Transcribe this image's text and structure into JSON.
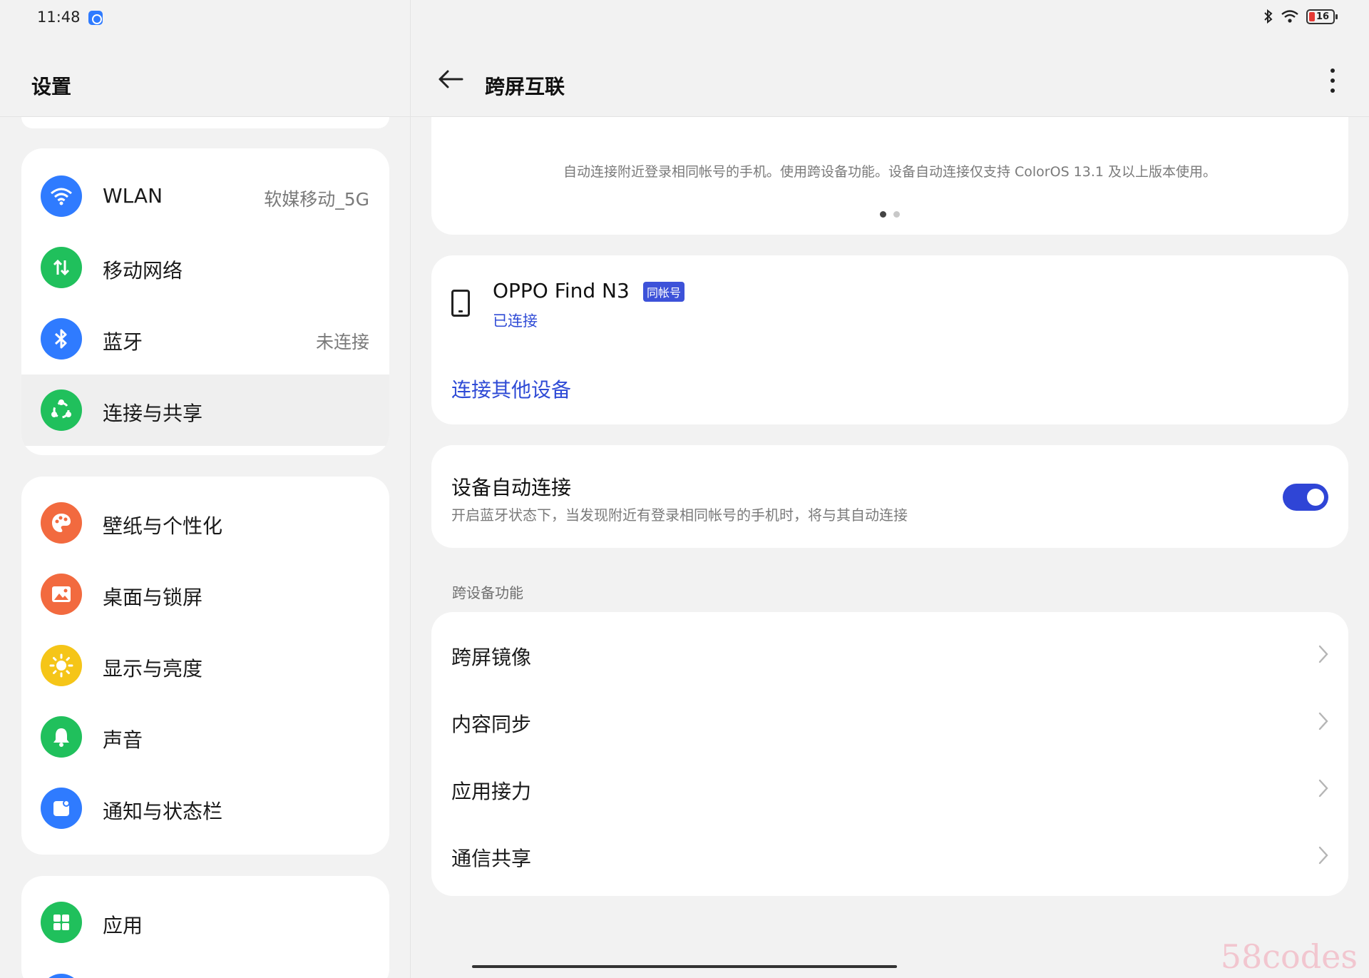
{
  "status_bar": {
    "time": "11:48",
    "app_icon": "message-app-icon",
    "battery": "16",
    "icons": [
      "bluetooth-icon",
      "wifi-icon",
      "battery-icon"
    ]
  },
  "left": {
    "title": "设置",
    "group1": [
      {
        "label": "WLAN",
        "value": "软媒移动_5G",
        "icon": "wifi-icon",
        "color": "#2f7bff"
      },
      {
        "label": "移动网络",
        "value": "",
        "icon": "mobile-data-icon",
        "color": "#20c05c"
      },
      {
        "label": "蓝牙",
        "value": "未连接",
        "icon": "bluetooth-icon",
        "color": "#2f7bff"
      },
      {
        "label": "连接与共享",
        "value": "",
        "icon": "share-icon",
        "color": "#20c05c",
        "selected": true
      }
    ],
    "group2": [
      {
        "label": "壁纸与个性化",
        "icon": "palette-icon",
        "color": "#f26a3f"
      },
      {
        "label": "桌面与锁屏",
        "icon": "image-icon",
        "color": "#f26a3f"
      },
      {
        "label": "显示与亮度",
        "icon": "sun-icon",
        "color": "#f5c518"
      },
      {
        "label": "声音",
        "icon": "bell-icon",
        "color": "#20c05c"
      },
      {
        "label": "通知与状态栏",
        "icon": "notification-icon",
        "color": "#2f7bff"
      }
    ],
    "group3": [
      {
        "label": "应用",
        "icon": "apps-grid-icon",
        "color": "#20c05c"
      }
    ]
  },
  "right": {
    "title": "跨屏互联",
    "info_text": "自动连接附近登录相同帐号的手机。使用跨设备功能。设备自动连接仅支持 ColorOS 13.1 及以上版本使用。",
    "device": {
      "name": "OPPO Find N3",
      "badge": "同帐号",
      "status": "已连接"
    },
    "connect_other": "连接其他设备",
    "auto_connect": {
      "title": "设备自动连接",
      "desc": "开启蓝牙状态下，当发现附近有登录相同帐号的手机时，将与其自动连接",
      "enabled": true
    },
    "section_label": "跨设备功能",
    "features": [
      "跨屏镜像",
      "内容同步",
      "应用接力",
      "通信共享"
    ]
  },
  "watermark": "58codes",
  "colors": {
    "accent": "#2f45d6",
    "link": "#2f4bd6",
    "background": "#f2f2f2"
  }
}
